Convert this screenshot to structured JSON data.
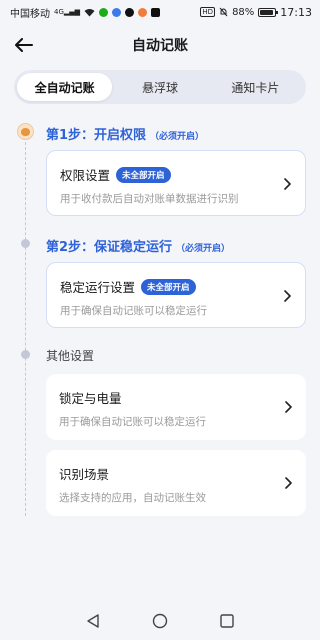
{
  "status_bar": {
    "carrier": "中国移动",
    "signal_tag": "4G",
    "battery_percent": "88%",
    "battery_level": 0.88,
    "time": "17:13",
    "hd_label": "HD"
  },
  "header": {
    "title": "自动记账"
  },
  "tabs": [
    {
      "label": "全自动记账",
      "active": true
    },
    {
      "label": "悬浮球",
      "active": false
    },
    {
      "label": "通知卡片",
      "active": false
    }
  ],
  "steps": [
    {
      "title": "第1步：开启权限",
      "note": "（必须开启）",
      "card": {
        "title": "权限设置",
        "badge": "未全部开启",
        "desc": "用于收付款后自动对账单数据进行识别"
      }
    },
    {
      "title": "第2步：保证稳定运行",
      "note": "（必须开启）",
      "card": {
        "title": "稳定运行设置",
        "badge": "未全部开启",
        "desc": "用于确保自动记账可以稳定运行"
      }
    }
  ],
  "other": {
    "title": "其他设置",
    "cards": [
      {
        "title": "锁定与电量",
        "desc": "用于确保自动记账可以稳定运行"
      },
      {
        "title": "识别场景",
        "desc": "选择支持的应用，自动记账生效"
      }
    ]
  },
  "colors": {
    "accent": "#2e63d8",
    "background": "#f4f5f9",
    "card": "#ffffff",
    "muted_text": "#9a9a9a"
  }
}
